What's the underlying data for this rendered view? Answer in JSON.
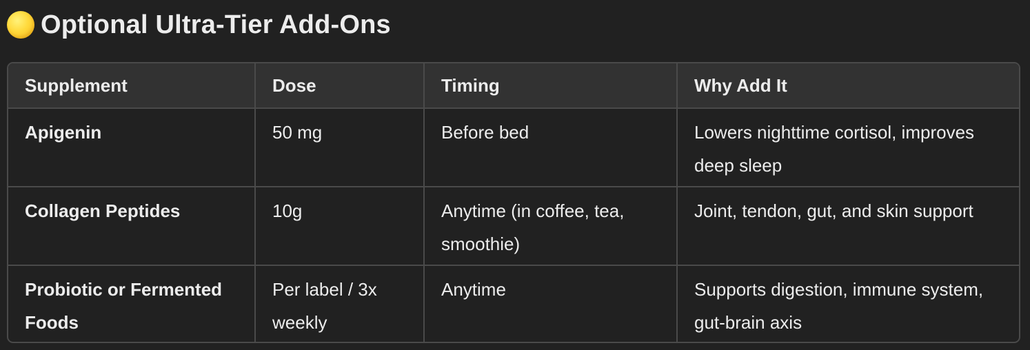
{
  "heading": {
    "emoji": "yellow-circle-icon",
    "title": "Optional Ultra-Tier Add-Ons"
  },
  "table": {
    "headers": [
      "Supplement",
      "Dose",
      "Timing",
      "Why Add It"
    ],
    "rows": [
      [
        "Apigenin",
        "50 mg",
        "Before bed",
        "Lowers nighttime cortisol, improves deep sleep"
      ],
      [
        "Collagen Peptides",
        "10g",
        "Anytime (in coffee, tea, smoothie)",
        "Joint, tendon, gut, and skin support"
      ],
      [
        "Probiotic or Fermented Foods",
        "Per label / 3x weekly",
        "Anytime",
        "Supports digestion, immune system, gut-brain axis"
      ]
    ]
  },
  "colors": {
    "background": "#212121",
    "header_row": "#323232",
    "border": "#4a4a4a",
    "text": "#ececec",
    "emoji_yellow": "#ffd93b"
  }
}
